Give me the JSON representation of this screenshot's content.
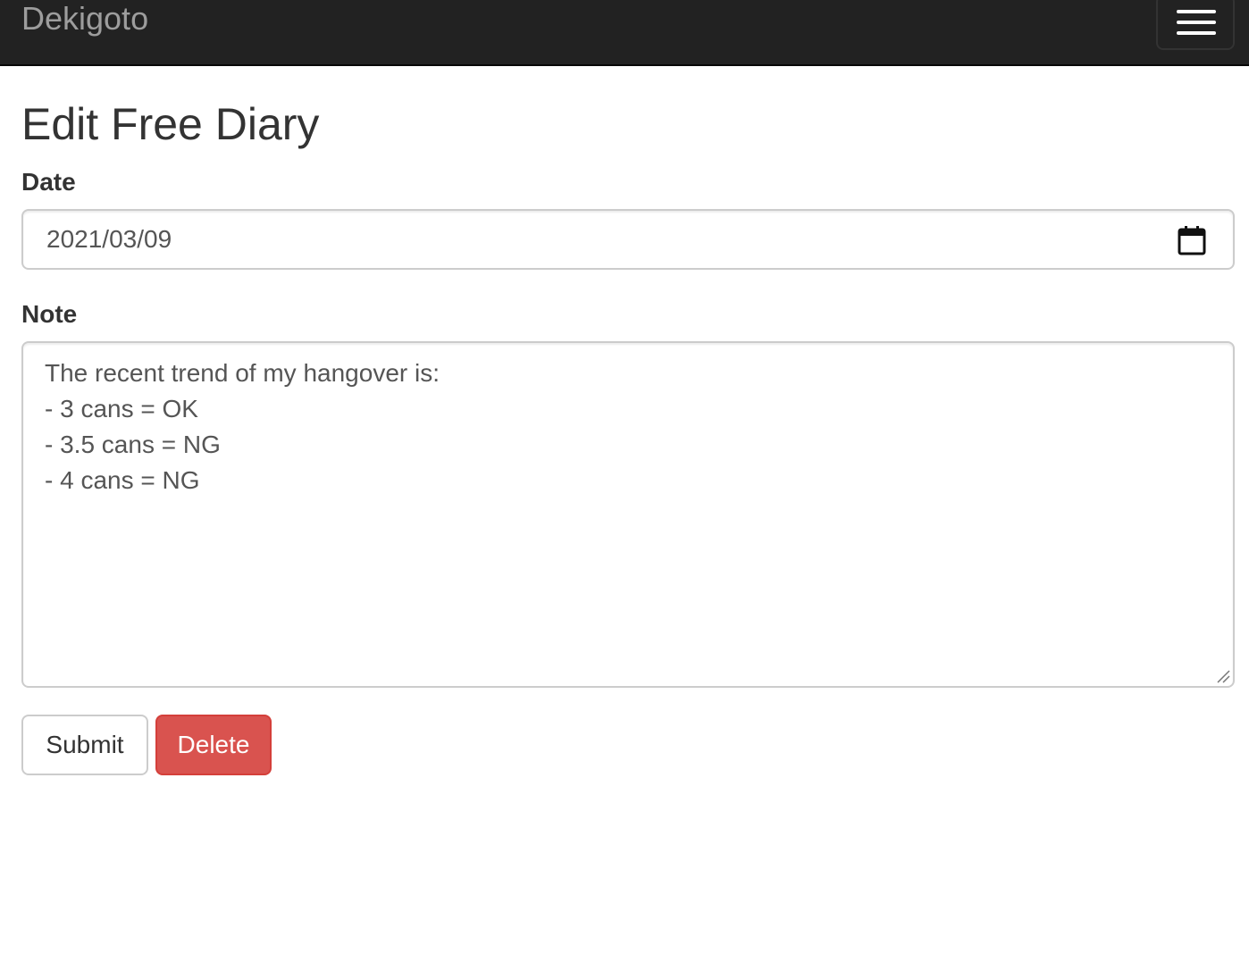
{
  "navbar": {
    "brand": "Dekigoto",
    "toggle_icon": "hamburger-menu-icon"
  },
  "page": {
    "title": "Edit Free Diary"
  },
  "form": {
    "date_label": "Date",
    "date_value": "2021/03/09",
    "date_icon": "calendar-icon",
    "note_label": "Note",
    "note_lines": [
      "The recent trend of my hangover is:",
      "- 3 cans = OK",
      "- 3.5 cans = NG",
      "- 4 cans = NG"
    ],
    "submit_label": "Submit",
    "delete_label": "Delete"
  },
  "colors": {
    "navbar_bg": "#222222",
    "brand_text": "#9d9d9d",
    "delete_bg": "#d9534f",
    "input_border": "#cccccc"
  }
}
